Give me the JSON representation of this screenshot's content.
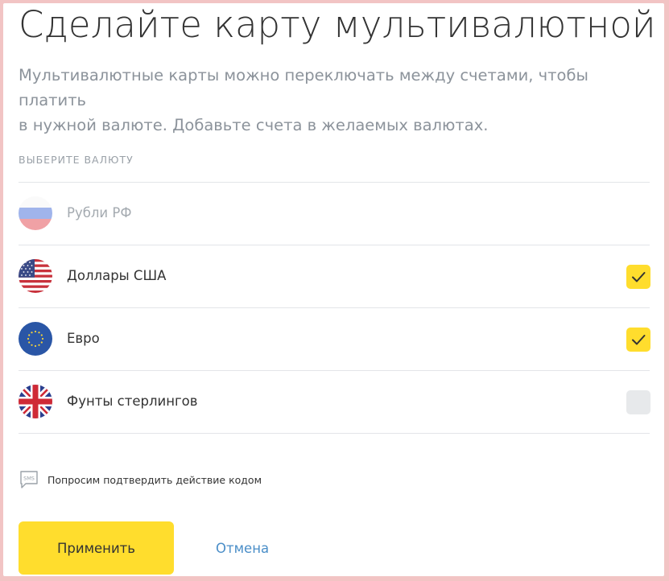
{
  "header": {
    "title": "Сделайте карту мультивалютной",
    "description_line1": "Мультивалютные карты можно переключать между счетами, чтобы платить",
    "description_line2": "в нужной валюте. Добавьте счета в желаемых валютах."
  },
  "currency_section": {
    "label": "ВЫБЕРИТЕ ВАЛЮТУ",
    "items": [
      {
        "label": "Рубли РФ",
        "flag": "russia-flag-icon",
        "state": "disabled"
      },
      {
        "label": "Доллары США",
        "flag": "usa-flag-icon",
        "checked": true
      },
      {
        "label": "Евро",
        "flag": "eu-flag-icon",
        "checked": true
      },
      {
        "label": "Фунты стерлингов",
        "flag": "uk-flag-icon",
        "checked": false
      }
    ]
  },
  "sms_notice": {
    "icon": "sms-icon",
    "text": "Попросим подтвердить действие кодом"
  },
  "actions": {
    "apply_label": "Применить",
    "cancel_label": "Отмена"
  },
  "colors": {
    "accent_yellow": "#ffdd2d",
    "link_blue": "#4a8ec8",
    "muted_text": "#8c939b"
  }
}
